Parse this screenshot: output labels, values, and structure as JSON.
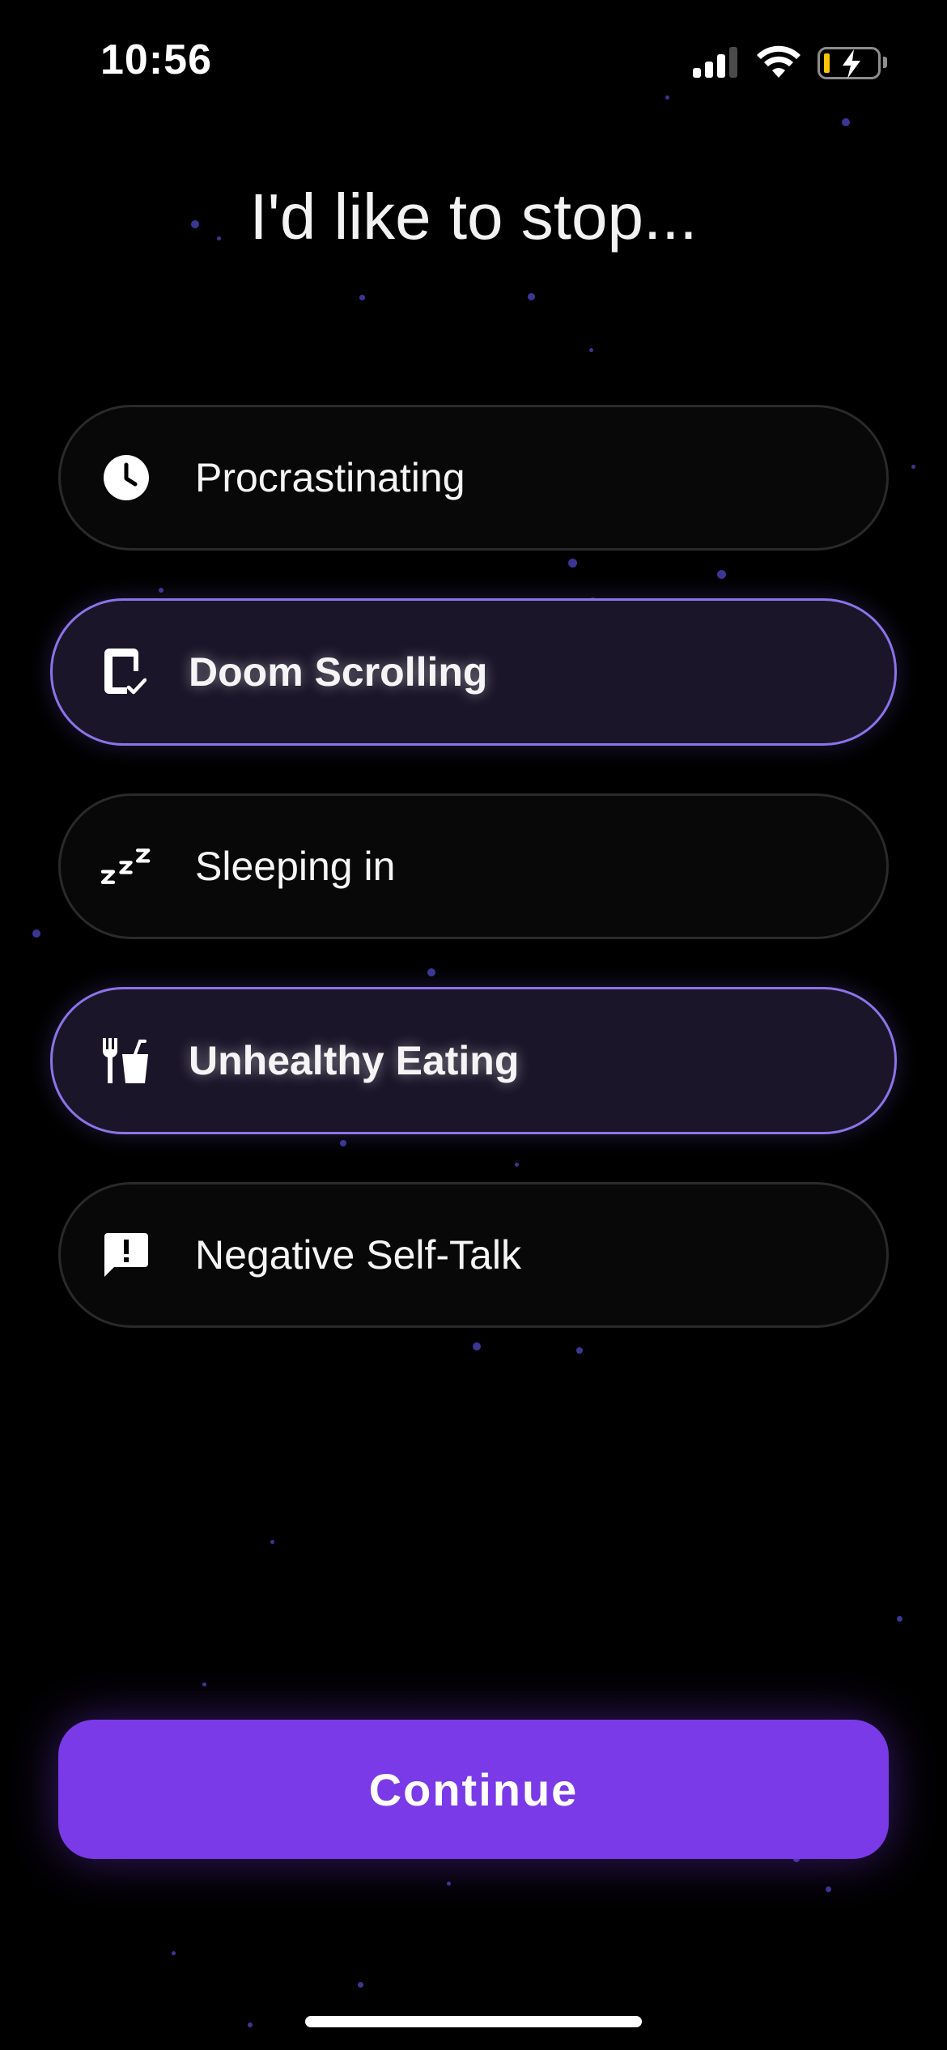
{
  "status_bar": {
    "time": "10:56"
  },
  "title": "I'd like to stop...",
  "options": [
    {
      "label": "Procrastinating",
      "icon": "clock-icon",
      "selected": false
    },
    {
      "label": "Doom Scrolling",
      "icon": "phone-check-icon",
      "selected": true
    },
    {
      "label": "Sleeping in",
      "icon": "zzz-sleep-icon",
      "selected": false
    },
    {
      "label": "Unhealthy Eating",
      "icon": "fork-knife-cup-icon",
      "selected": true
    },
    {
      "label": "Negative Self-Talk",
      "icon": "speech-bubble-exclamation-icon",
      "selected": false
    }
  ],
  "continue_label": "Continue",
  "colors": {
    "accent": "#7a3ae8",
    "selected_border": "#8b74e8",
    "selected_bg": "#1b1529",
    "background": "#000000"
  }
}
